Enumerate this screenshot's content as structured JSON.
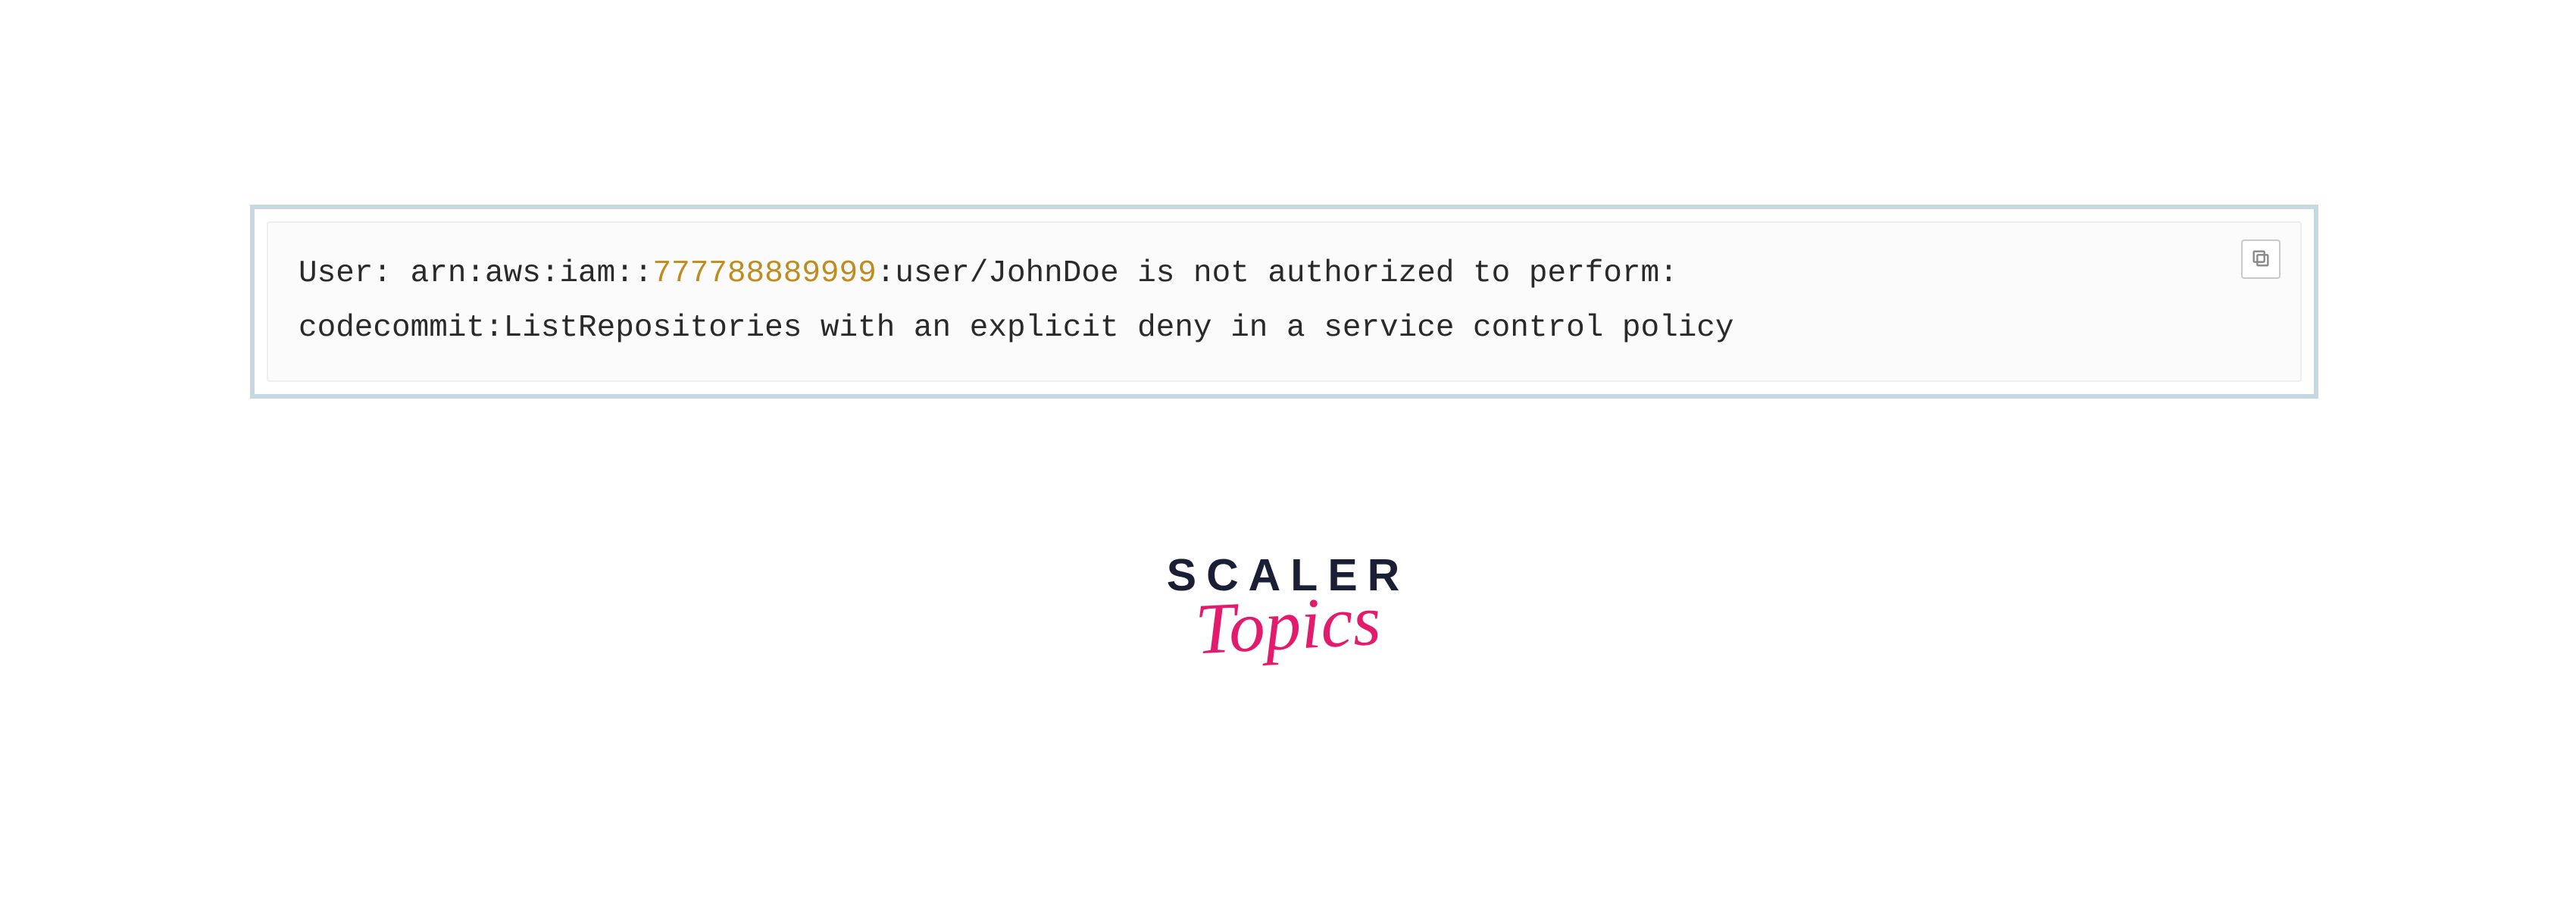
{
  "code": {
    "line1_prefix": "User: arn:aws:iam::",
    "line1_number": "777788889999",
    "line1_suffix": ":user/JohnDoe is not authorized to perform:",
    "line2": "codecommit:ListRepositories with an explicit deny in a service control policy"
  },
  "logo": {
    "line1": "SCALER",
    "line2": "Topics"
  }
}
